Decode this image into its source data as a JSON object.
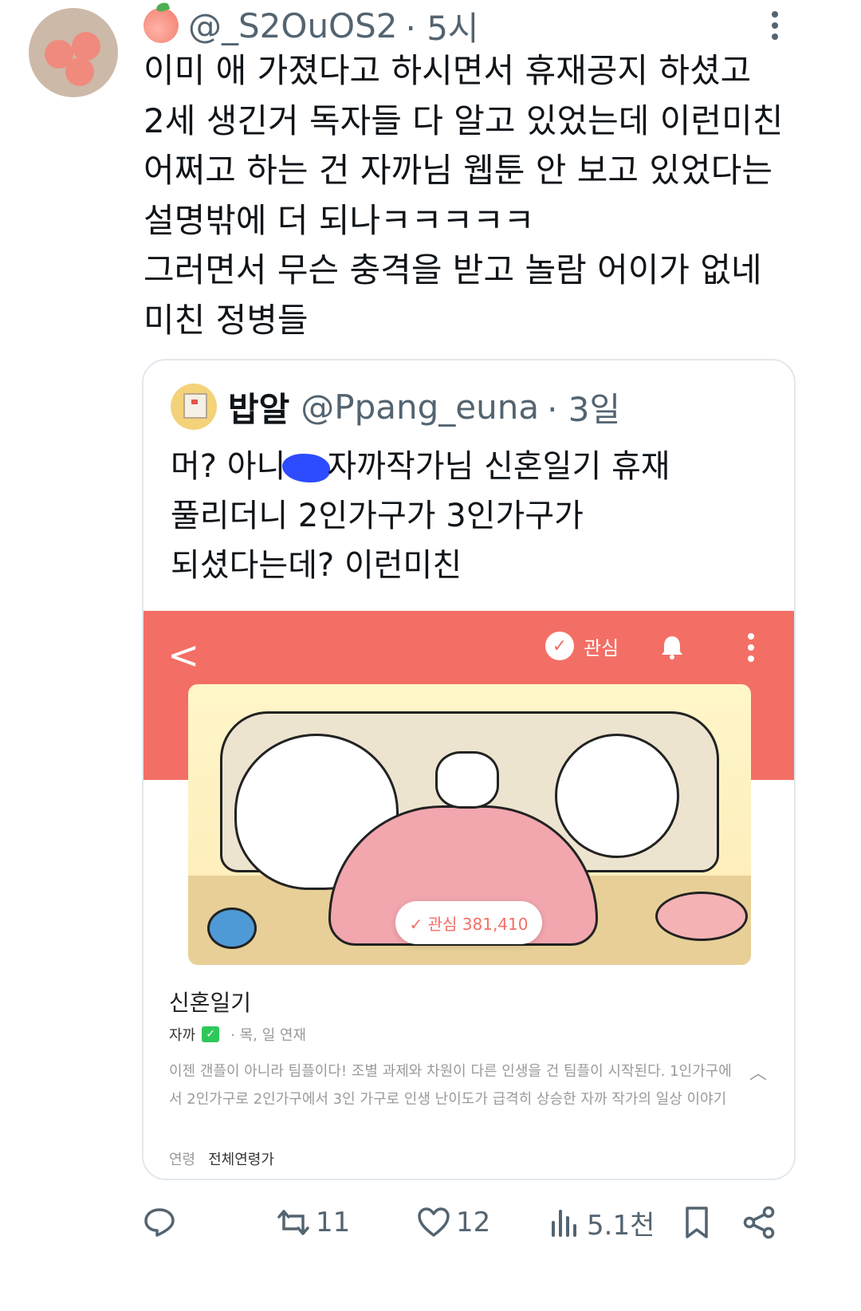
{
  "author": {
    "handle": "@_S2OuOS2",
    "time": "· 5시"
  },
  "tweet": {
    "lines": [
      "이미 애 가졌다고 하시면서 휴재공지 하셨고",
      "2세 생긴거 독자들 다 알고 있었는데 이런미친",
      "어쩌고 하는 건 자까님 웹툰 안 보고 있었다는",
      "설명밖에 더 되나ㅋㅋㅋㅋㅋ",
      "그러면서 무슨 충격을 받고 놀람 어이가 없네",
      "미친 정병들"
    ]
  },
  "quote": {
    "name": "밥알",
    "handle": "@Ppang_euna",
    "time": "· 3일",
    "line1_a": "머? 아니",
    "line1_b": "자까작가님 신혼일기 휴재",
    "line2": "풀리더니 2인가구가 3인가구가",
    "line3": "되셨다는데? 이런미친",
    "screenshot": {
      "back": "<",
      "fav_label": "관심",
      "fav_pill": "✓ 관심 381,410",
      "title": "신혼일기",
      "author": "자까",
      "schedule": "· 목, 일 연재",
      "description": "이젠 갠플이 아니라 팀플이다! 조별 과제와 차원이 다른 인생을 건 팀플이 시작된다. 1인가구에서 2인가구로 2인가구에서 3인 가구로 인생 난이도가 급격히 상승한 자까 작가의 일상 이야기",
      "age_label": "연령",
      "age_value": "전체연령가"
    }
  },
  "actions": {
    "reply": "",
    "retweet": "11",
    "like": "12",
    "views": "5.1천"
  },
  "colors": {
    "accent": "#f36f66",
    "text": "#0f1419",
    "muted": "#536471"
  }
}
